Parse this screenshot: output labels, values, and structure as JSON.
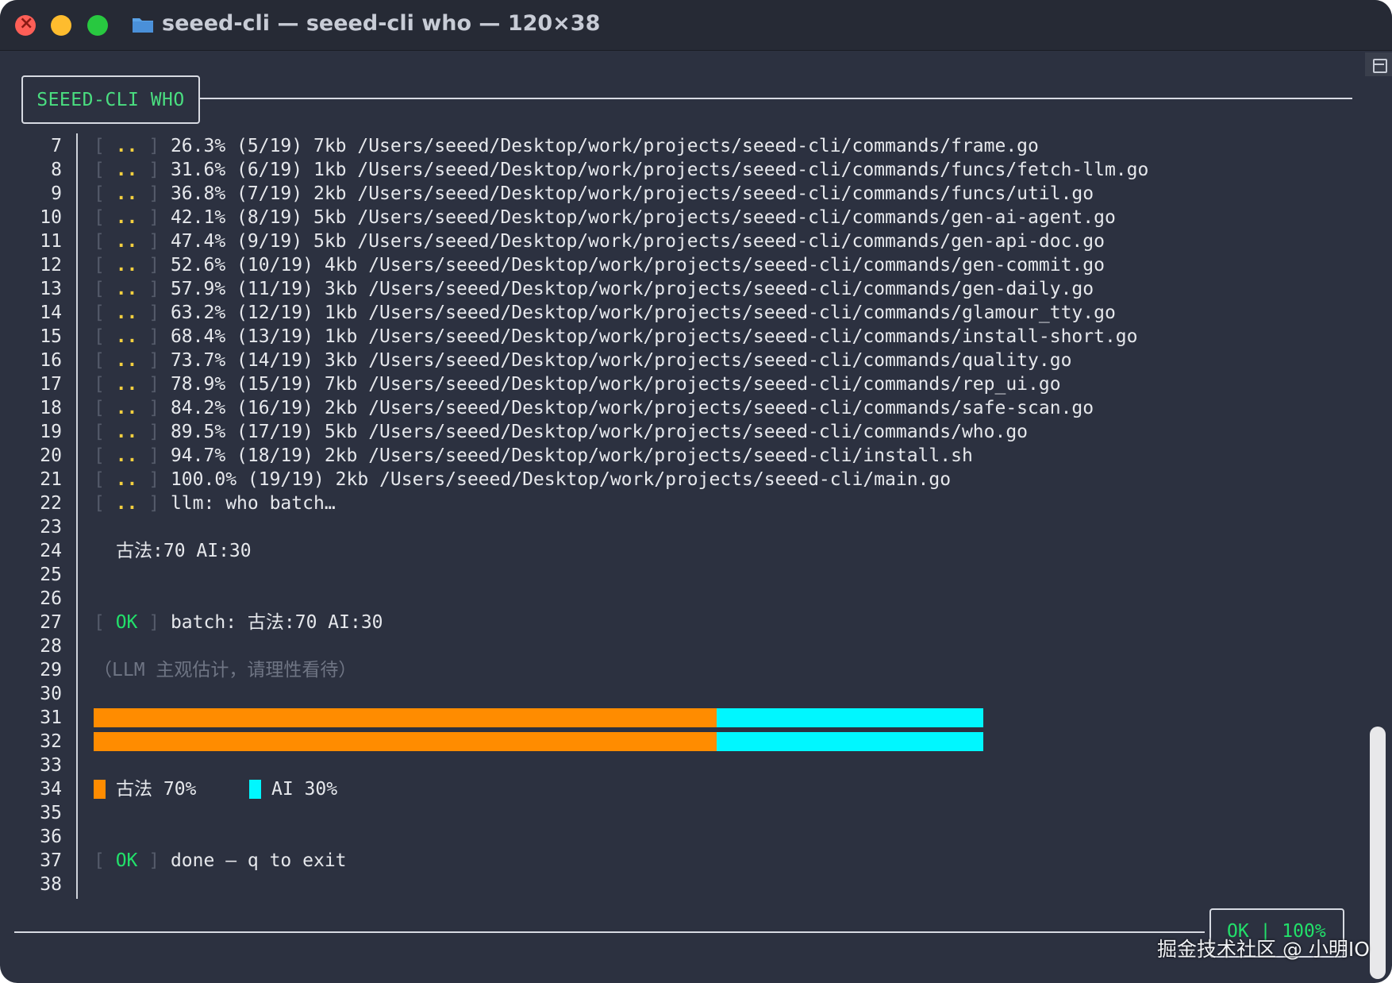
{
  "window": {
    "title": "seeed-cli — seeed-cli who — 120×38"
  },
  "header": {
    "label": "SEEED-CLI WHO"
  },
  "progress_rows": [
    {
      "line": "7",
      "tag": "..",
      "text": "26.3% (5/19) 7kb /Users/seeed/Desktop/work/projects/seeed-cli/commands/frame.go"
    },
    {
      "line": "8",
      "tag": "..",
      "text": "31.6% (6/19) 1kb /Users/seeed/Desktop/work/projects/seeed-cli/commands/funcs/fetch-llm.go"
    },
    {
      "line": "9",
      "tag": "..",
      "text": "36.8% (7/19) 2kb /Users/seeed/Desktop/work/projects/seeed-cli/commands/funcs/util.go"
    },
    {
      "line": "10",
      "tag": "..",
      "text": "42.1% (8/19) 5kb /Users/seeed/Desktop/work/projects/seeed-cli/commands/gen-ai-agent.go"
    },
    {
      "line": "11",
      "tag": "..",
      "text": "47.4% (9/19) 5kb /Users/seeed/Desktop/work/projects/seeed-cli/commands/gen-api-doc.go"
    },
    {
      "line": "12",
      "tag": "..",
      "text": "52.6% (10/19) 4kb /Users/seeed/Desktop/work/projects/seeed-cli/commands/gen-commit.go"
    },
    {
      "line": "13",
      "tag": "..",
      "text": "57.9% (11/19) 3kb /Users/seeed/Desktop/work/projects/seeed-cli/commands/gen-daily.go"
    },
    {
      "line": "14",
      "tag": "..",
      "text": "63.2% (12/19) 1kb /Users/seeed/Desktop/work/projects/seeed-cli/commands/glamour_tty.go"
    },
    {
      "line": "15",
      "tag": "..",
      "text": "68.4% (13/19) 1kb /Users/seeed/Desktop/work/projects/seeed-cli/commands/install-short.go"
    },
    {
      "line": "16",
      "tag": "..",
      "text": "73.7% (14/19) 3kb /Users/seeed/Desktop/work/projects/seeed-cli/commands/quality.go"
    },
    {
      "line": "17",
      "tag": "..",
      "text": "78.9% (15/19) 7kb /Users/seeed/Desktop/work/projects/seeed-cli/commands/rep_ui.go"
    },
    {
      "line": "18",
      "tag": "..",
      "text": "84.2% (16/19) 2kb /Users/seeed/Desktop/work/projects/seeed-cli/commands/safe-scan.go"
    },
    {
      "line": "19",
      "tag": "..",
      "text": "89.5% (17/19) 5kb /Users/seeed/Desktop/work/projects/seeed-cli/commands/who.go"
    },
    {
      "line": "20",
      "tag": "..",
      "text": "94.7% (18/19) 2kb /Users/seeed/Desktop/work/projects/seeed-cli/install.sh"
    },
    {
      "line": "21",
      "tag": "..",
      "text": "100.0% (19/19) 2kb /Users/seeed/Desktop/work/projects/seeed-cli/main.go"
    },
    {
      "line": "22",
      "tag": "..",
      "text": "llm: who batch…"
    }
  ],
  "empty_lines": [
    "23",
    "25",
    "26",
    "28",
    "30",
    "33",
    "35",
    "36",
    "38"
  ],
  "result": {
    "line": "24",
    "text": "古法:70 AI:30"
  },
  "batch_ok": {
    "line": "27",
    "tag": "OK",
    "text": "batch: 古法:70 AI:30"
  },
  "note": {
    "line": "29",
    "text": "（LLM 主观估计，请理性看待）"
  },
  "bars": {
    "lines": [
      "31",
      "32"
    ],
    "segments": [
      {
        "label": "古法",
        "percent": 70,
        "color": "#ff8c00"
      },
      {
        "label": "AI",
        "percent": 30,
        "color": "#00f7ff"
      }
    ]
  },
  "legend": {
    "line": "34",
    "items": [
      {
        "label": "古法 70%",
        "color": "#ff8c00"
      },
      {
        "label": "AI 30%",
        "color": "#00f7ff"
      }
    ]
  },
  "done": {
    "line": "37",
    "tag": "OK",
    "text": "done — q to exit"
  },
  "status": {
    "ok": "OK",
    "sep": "|",
    "percent": "100%"
  },
  "watermark": "掘金技术社区 @ 小明IO",
  "colors": {
    "background": "#2c3140",
    "ok_green": "#22e06a",
    "progress_dots": "#f4d03f"
  }
}
